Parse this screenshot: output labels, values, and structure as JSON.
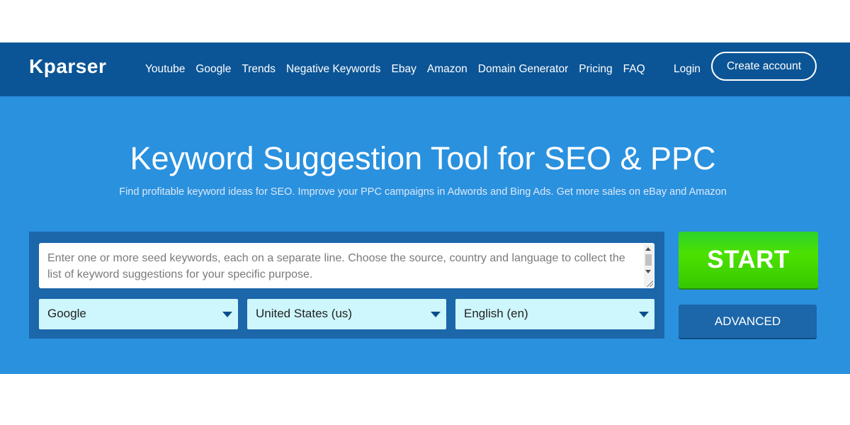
{
  "header": {
    "logo": "Kparser",
    "nav": [
      {
        "label": "Youtube"
      },
      {
        "label": "Google"
      },
      {
        "label": "Trends"
      },
      {
        "label": "Negative Keywords"
      },
      {
        "label": "Ebay"
      },
      {
        "label": "Amazon"
      },
      {
        "label": "Domain Generator"
      },
      {
        "label": "Pricing"
      },
      {
        "label": "FAQ"
      }
    ],
    "login_label": "Login",
    "create_account_label": "Create account"
  },
  "hero": {
    "title": "Keyword Suggestion Tool for SEO & PPC",
    "subtitle": "Find profitable keyword ideas for SEO. Improve your PPC campaigns in Adwords and Bing Ads. Get more sales on eBay and Amazon"
  },
  "search": {
    "placeholder": "Enter one or more seed keywords, each on a separate line. Choose the source, country and language to collect the list of keyword suggestions for your specific purpose.",
    "source": "Google",
    "country": "United States (us)",
    "language": "English (en)",
    "start_label": "START",
    "advanced_label": "ADVANCED"
  },
  "colors": {
    "header_bg": "#0b5596",
    "hero_bg": "#2a91df",
    "panel_bg": "#1c66aa",
    "select_bg": "#cdf6fd",
    "start_green": "#4ce100"
  },
  "icons": [
    "chevron-down-icon",
    "scroll-up-icon",
    "scroll-down-icon",
    "resize-grip-icon"
  ]
}
